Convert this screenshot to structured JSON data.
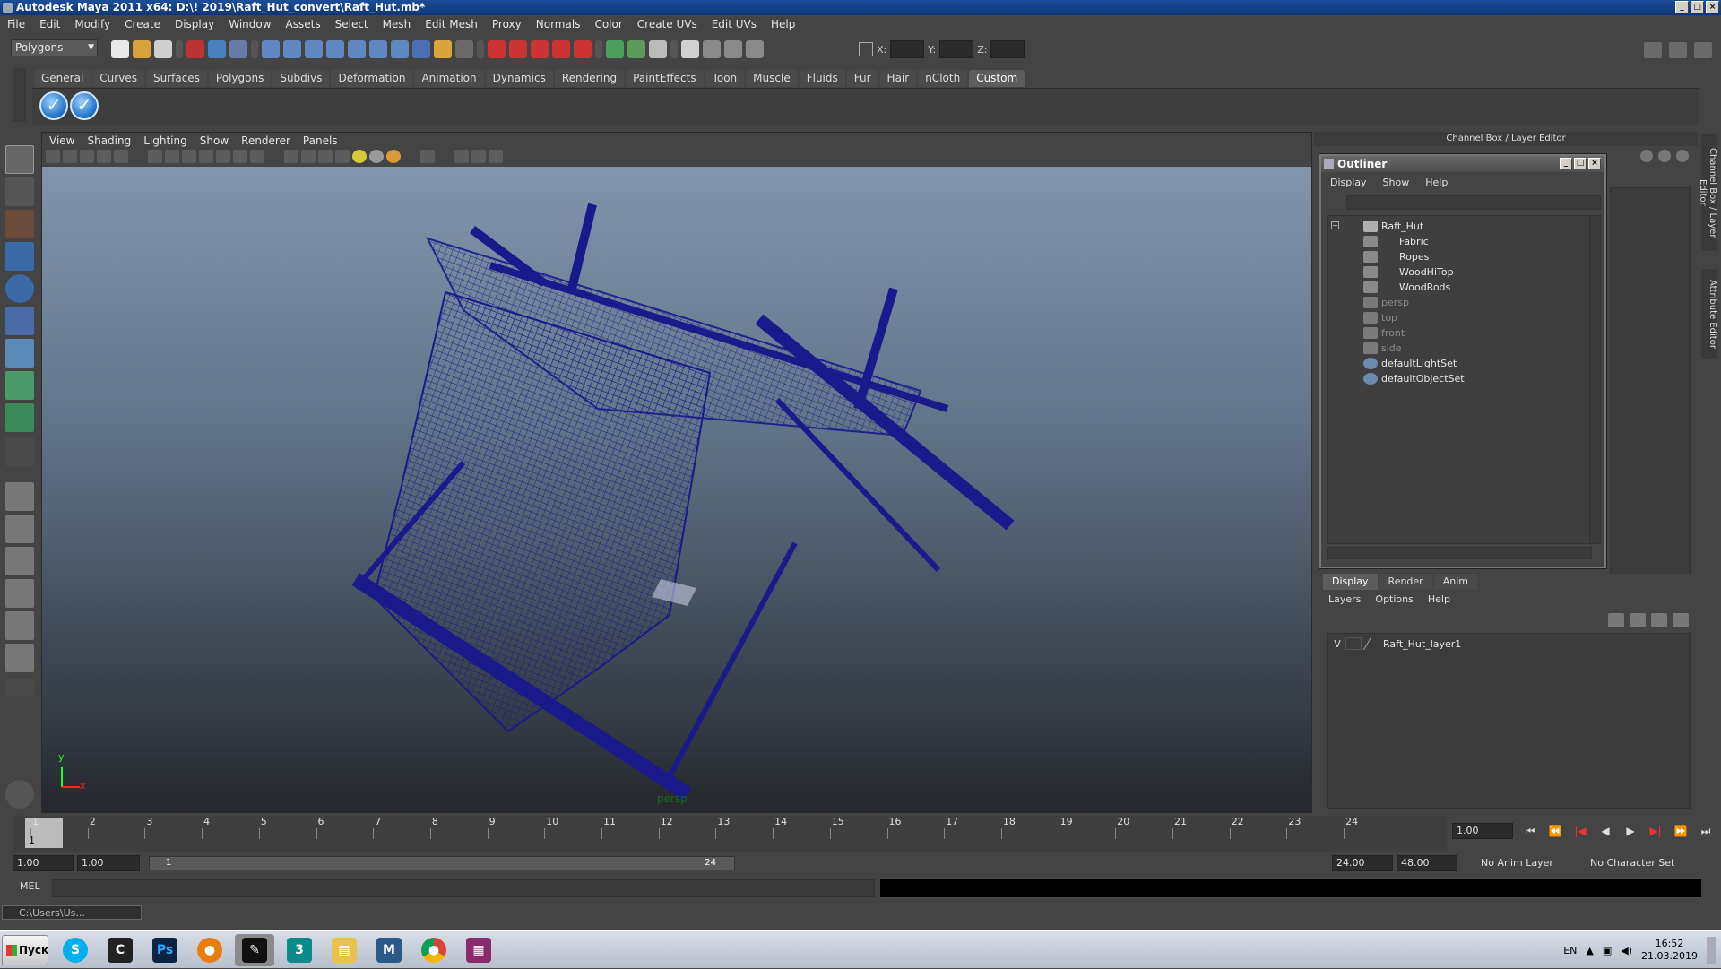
{
  "window": {
    "title": "Autodesk Maya 2011 x64: D:\\! 2019\\Raft_Hut_convert\\Raft_Hut.mb*"
  },
  "menubar": [
    "File",
    "Edit",
    "Modify",
    "Create",
    "Display",
    "Window",
    "Assets",
    "Select",
    "Mesh",
    "Edit Mesh",
    "Proxy",
    "Normals",
    "Color",
    "Create UVs",
    "Edit UVs",
    "Help"
  ],
  "statusline": {
    "mode": "Polygons",
    "x_label": "X:",
    "y_label": "Y:",
    "z_label": "Z:"
  },
  "shelf": {
    "tabs": [
      "General",
      "Curves",
      "Surfaces",
      "Polygons",
      "Subdivs",
      "Deformation",
      "Animation",
      "Dynamics",
      "Rendering",
      "PaintEffects",
      "Toon",
      "Muscle",
      "Fluids",
      "Fur",
      "Hair",
      "nCloth",
      "Custom"
    ],
    "active_tab": "Custom"
  },
  "viewport": {
    "menu": [
      "View",
      "Shading",
      "Lighting",
      "Show",
      "Renderer",
      "Panels"
    ],
    "camera": "persp",
    "axis_y": "y",
    "axis_x": "x",
    "wire_color": "#1a1a8c"
  },
  "channelbox": {
    "title": "Channel Box / Layer Editor"
  },
  "outliner": {
    "title": "Outliner",
    "menu": [
      "Display",
      "Show",
      "Help"
    ],
    "items": [
      {
        "label": "Raft_Hut",
        "depth": 0,
        "icon": "group-icon",
        "dim": false
      },
      {
        "label": "Fabric",
        "depth": 1,
        "icon": "mesh-icon",
        "dim": false
      },
      {
        "label": "Ropes",
        "depth": 1,
        "icon": "mesh-icon",
        "dim": false
      },
      {
        "label": "WoodHiTop",
        "depth": 1,
        "icon": "mesh-icon",
        "dim": false
      },
      {
        "label": "WoodRods",
        "depth": 1,
        "icon": "mesh-icon",
        "dim": false
      },
      {
        "label": "persp",
        "depth": 0,
        "icon": "camera-icon",
        "dim": true
      },
      {
        "label": "top",
        "depth": 0,
        "icon": "camera-icon",
        "dim": true
      },
      {
        "label": "front",
        "depth": 0,
        "icon": "camera-icon",
        "dim": true
      },
      {
        "label": "side",
        "depth": 0,
        "icon": "camera-icon",
        "dim": true
      },
      {
        "label": "defaultLightSet",
        "depth": 0,
        "icon": "set-icon",
        "dim": false
      },
      {
        "label": "defaultObjectSet",
        "depth": 0,
        "icon": "set-icon",
        "dim": false
      }
    ]
  },
  "layereditor": {
    "tabs": [
      "Display",
      "Render",
      "Anim"
    ],
    "active_tab": "Display",
    "menu": [
      "Layers",
      "Options",
      "Help"
    ],
    "layer": {
      "visible": "V",
      "name": "Raft_Hut_layer1"
    }
  },
  "side_tabs": [
    "Channel Box / Layer Editor",
    "Attribute Editor"
  ],
  "timeslider": {
    "ticks": [
      "1",
      "2",
      "3",
      "4",
      "5",
      "6",
      "7",
      "8",
      "9",
      "10",
      "11",
      "12",
      "13",
      "14",
      "15",
      "16",
      "17",
      "18",
      "19",
      "20",
      "21",
      "22",
      "23",
      "24"
    ],
    "current": "1",
    "current_frame_field": "1.00"
  },
  "rangeslider": {
    "start_time": "1.00",
    "playback_start": "1.00",
    "range_start": "1",
    "range_end": "24",
    "playback_end": "24.00",
    "end_time": "48.00",
    "anim_layer": "No Anim Layer",
    "char_set": "No Character Set"
  },
  "commandline": {
    "label": "MEL"
  },
  "helpline": {
    "minimized_window": "C:\\Users\\Us..."
  },
  "taskbar": {
    "start": "Пуск",
    "apps": [
      "Skype",
      "Cinema",
      "Ps",
      "Blender",
      "Inkscape",
      "3ds Max",
      "Explorer",
      "Maya",
      "Chrome",
      "WinRAR"
    ],
    "lang": "EN",
    "time": "16:52",
    "date": "21.03.2019"
  }
}
